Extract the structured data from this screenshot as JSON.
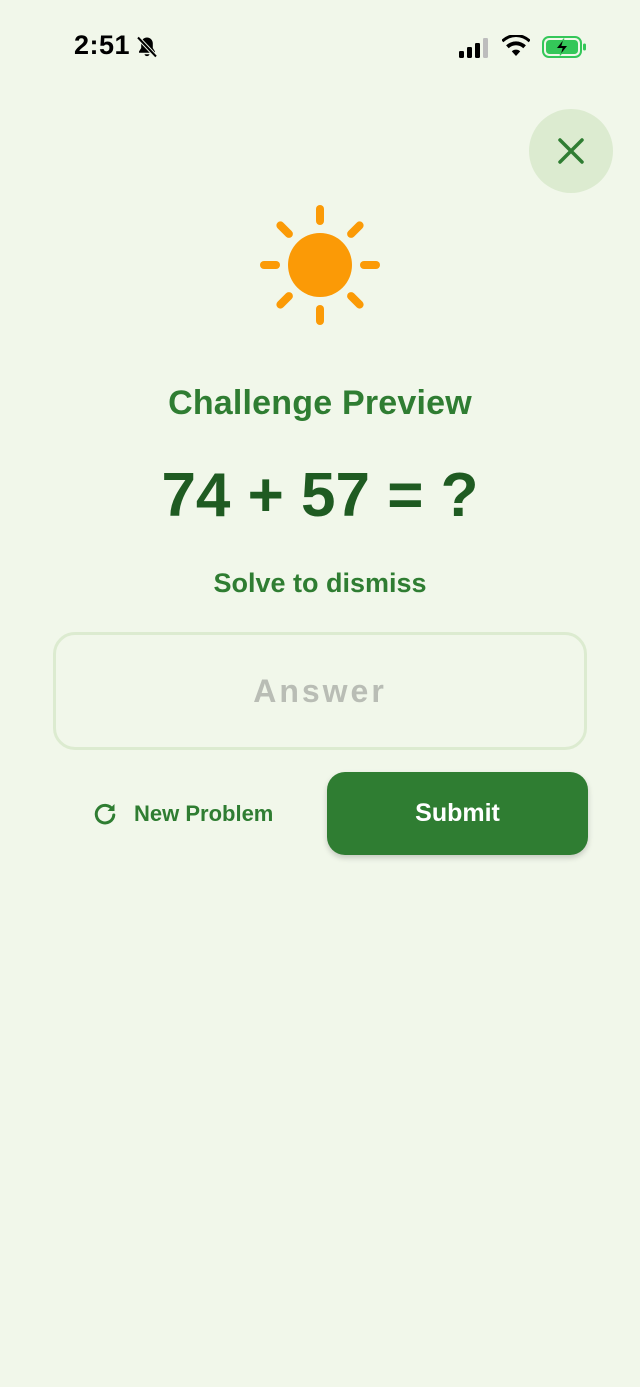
{
  "status_bar": {
    "time": "2:51",
    "icons": [
      "bell-slash-icon",
      "cellular-signal-icon",
      "wifi-icon",
      "battery-charging-icon"
    ]
  },
  "close_button": {
    "icon": "close-icon"
  },
  "hero_icon": "sun-icon",
  "challenge": {
    "title": "Challenge Preview",
    "problem": "74 + 57 = ?",
    "subtitle": "Solve to dismiss"
  },
  "answer_input": {
    "value": "",
    "placeholder": "Answer"
  },
  "actions": {
    "new_problem_label": "New Problem",
    "new_problem_icon": "refresh-icon",
    "submit_label": "Submit"
  },
  "colors": {
    "background": "#f1f7ea",
    "primary": "#2f7d32",
    "primary_dark": "#1f5b22",
    "close_bg": "#dcebd0",
    "sun": "#fb9a06",
    "battery": "#34c759"
  }
}
